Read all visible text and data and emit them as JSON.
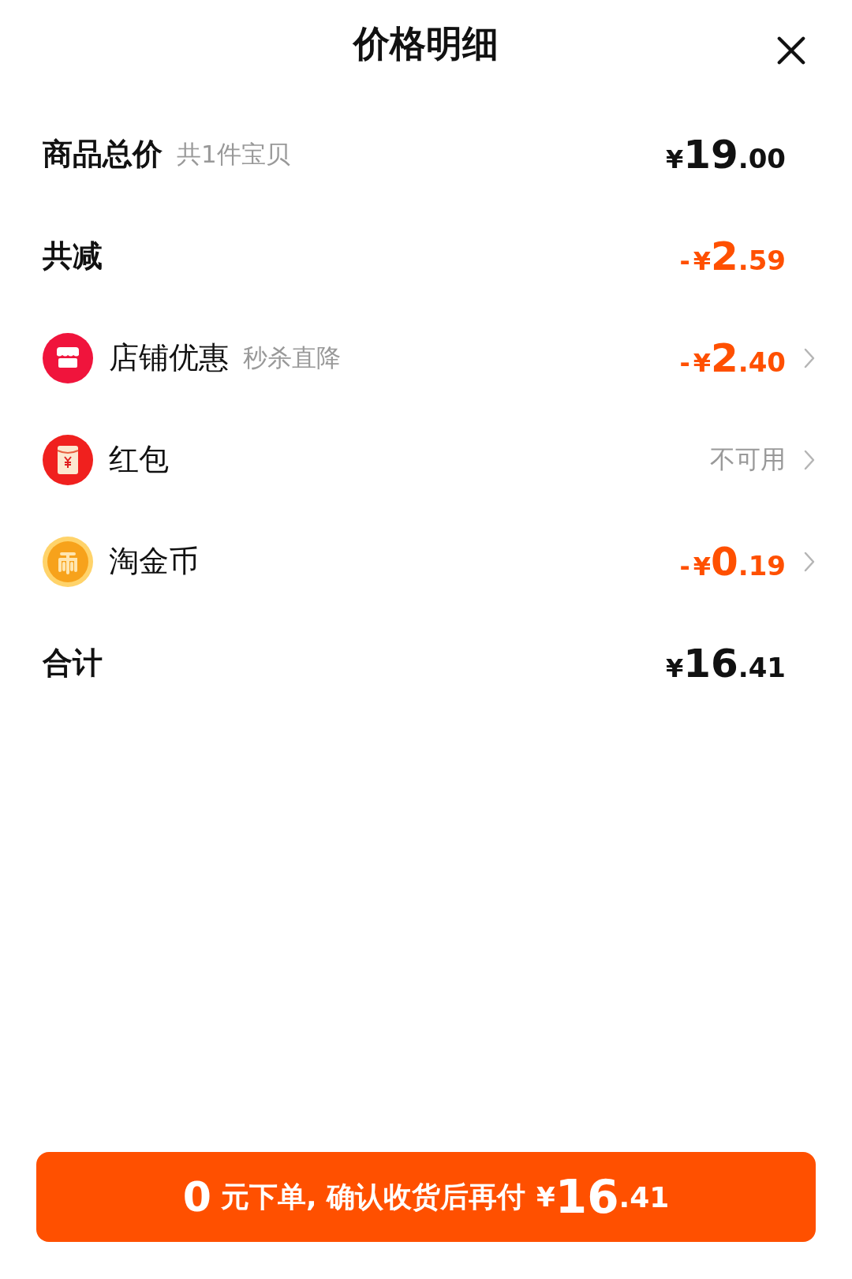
{
  "title": "价格明细",
  "rows": [
    {
      "kind": "plain",
      "label": "商品总价",
      "note": "共1件宝贝",
      "amount": {
        "currency": "¥",
        "main": "19",
        "fraction": ".00"
      },
      "chevron": false
    },
    {
      "kind": "plain",
      "label": "共减",
      "amount": {
        "sign": "-",
        "currency": "¥",
        "main": "2",
        "fraction": ".59"
      },
      "chevron": false
    },
    {
      "kind": "shop",
      "label": "店铺优惠",
      "note": "秒杀直降",
      "amount": {
        "sign": "-",
        "currency": "¥",
        "main": "2",
        "fraction": ".40"
      },
      "chevron": true
    },
    {
      "kind": "envelope",
      "label": "红包",
      "status": "不可用",
      "chevron": true
    },
    {
      "kind": "coin",
      "label": "淘金币",
      "amount": {
        "sign": "-",
        "currency": "¥",
        "main": "0",
        "fraction": ".19"
      },
      "chevron": true
    },
    {
      "kind": "plain",
      "label": "合计",
      "amount": {
        "currency": "¥",
        "main": "16",
        "fraction": ".41"
      },
      "chevron": false
    }
  ],
  "button": {
    "lead": "0",
    "text": "元下单, 确认收货后再付",
    "currency": "¥",
    "main": "16",
    "fraction": ".41"
  }
}
